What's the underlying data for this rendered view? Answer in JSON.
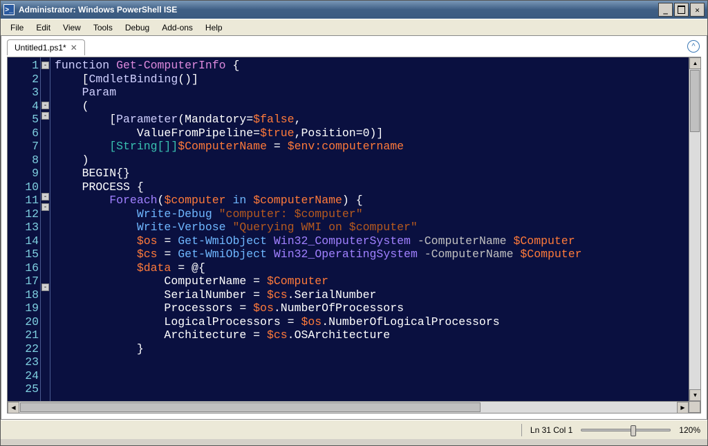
{
  "window": {
    "title": "Administrator: Windows PowerShell ISE",
    "icon_glyph": ">_"
  },
  "menu": {
    "items": [
      "File",
      "Edit",
      "View",
      "Tools",
      "Debug",
      "Add-ons",
      "Help"
    ]
  },
  "tabs": {
    "active": {
      "label": "Untitled1.ps1*",
      "close_glyph": "✕"
    },
    "help_glyph": "ⓘ"
  },
  "editor": {
    "line_numbers": [
      1,
      2,
      3,
      4,
      5,
      6,
      7,
      8,
      9,
      10,
      11,
      12,
      13,
      14,
      15,
      16,
      17,
      18,
      19,
      20,
      21,
      22,
      23,
      24,
      25
    ],
    "folds": {
      "1": "-",
      "4": "-",
      "5": "-",
      "11": "-",
      "12": "-",
      "18": "-"
    },
    "code_lines": [
      [
        [
          "k-blue",
          "function "
        ],
        [
          "k-fn",
          "Get-ComputerInfo"
        ],
        [
          "k-kw",
          " {"
        ]
      ],
      [
        [
          "k-kw",
          "    ["
        ],
        [
          "k-attr",
          "CmdletBinding"
        ],
        [
          "k-kw",
          "()]"
        ]
      ],
      [
        [
          "k-blue",
          "    Param"
        ]
      ],
      [
        [
          "k-kw",
          "    ("
        ]
      ],
      [
        [
          "k-kw",
          "        ["
        ],
        [
          "k-attr",
          "Parameter"
        ],
        [
          "k-kw",
          "(Mandatory="
        ],
        [
          "k-var",
          "$false"
        ],
        [
          "k-kw",
          ","
        ]
      ],
      [
        [
          "k-kw",
          "            ValueFromPipeline="
        ],
        [
          "k-var",
          "$true"
        ],
        [
          "k-kw",
          ",Position=0)]"
        ]
      ],
      [
        [
          "k-kw",
          "        "
        ],
        [
          "k-type",
          "[String[]]"
        ],
        [
          "k-var",
          "$ComputerName"
        ],
        [
          "k-kw",
          " = "
        ],
        [
          "k-var",
          "$env:computername"
        ]
      ],
      [
        [
          "k-kw",
          "    )"
        ]
      ],
      [
        [
          "k-kw",
          ""
        ]
      ],
      [
        [
          "k-kw",
          "    BEGIN{}"
        ]
      ],
      [
        [
          "k-kw",
          "    PROCESS {"
        ]
      ],
      [
        [
          "k-kw",
          "        "
        ],
        [
          "k-fore",
          "Foreach"
        ],
        [
          "k-kw",
          "("
        ],
        [
          "k-var",
          "$computer"
        ],
        [
          "k-kw",
          " "
        ],
        [
          "k-cmd",
          "in"
        ],
        [
          "k-kw",
          " "
        ],
        [
          "k-var",
          "$computerName"
        ],
        [
          "k-kw",
          ") {"
        ]
      ],
      [
        [
          "k-kw",
          "            "
        ],
        [
          "k-cmd",
          "Write-Debug"
        ],
        [
          "k-kw",
          " "
        ],
        [
          "k-str",
          "\"computer: $computer\""
        ]
      ],
      [
        [
          "k-kw",
          "            "
        ],
        [
          "k-cmd",
          "Write-Verbose"
        ],
        [
          "k-kw",
          " "
        ],
        [
          "k-str",
          "\"Querying WMI on $computer\""
        ]
      ],
      [
        [
          "k-kw",
          "            "
        ],
        [
          "k-var",
          "$os"
        ],
        [
          "k-kw",
          " = "
        ],
        [
          "k-cmd",
          "Get-WmiObject"
        ],
        [
          "k-kw",
          " "
        ],
        [
          "k-wmi",
          "Win32_ComputerSystem"
        ],
        [
          "k-kw",
          " "
        ],
        [
          "k-flag",
          "-ComputerName"
        ],
        [
          "k-kw",
          " "
        ],
        [
          "k-var",
          "$Computer"
        ]
      ],
      [
        [
          "k-kw",
          "            "
        ],
        [
          "k-var",
          "$cs"
        ],
        [
          "k-kw",
          " = "
        ],
        [
          "k-cmd",
          "Get-WmiObject"
        ],
        [
          "k-kw",
          " "
        ],
        [
          "k-wmi",
          "Win32_OperatingSystem"
        ],
        [
          "k-kw",
          " "
        ],
        [
          "k-flag",
          "-ComputerName"
        ],
        [
          "k-kw",
          " "
        ],
        [
          "k-var",
          "$Computer"
        ]
      ],
      [
        [
          "k-kw",
          ""
        ]
      ],
      [
        [
          "k-kw",
          "            "
        ],
        [
          "k-var",
          "$data"
        ],
        [
          "k-kw",
          " = @{"
        ]
      ],
      [
        [
          "k-kw",
          "                ComputerName = "
        ],
        [
          "k-var",
          "$Computer"
        ]
      ],
      [
        [
          "k-kw",
          "                SerialNumber = "
        ],
        [
          "k-var",
          "$cs"
        ],
        [
          "k-prop",
          ".SerialNumber"
        ]
      ],
      [
        [
          "k-kw",
          "                Processors = "
        ],
        [
          "k-var",
          "$os"
        ],
        [
          "k-prop",
          ".NumberOfProcessors"
        ]
      ],
      [
        [
          "k-kw",
          "                LogicalProcessors = "
        ],
        [
          "k-var",
          "$os"
        ],
        [
          "k-prop",
          ".NumberOfLogicalProcessors"
        ]
      ],
      [
        [
          "k-kw",
          "                Architecture = "
        ],
        [
          "k-var",
          "$cs"
        ],
        [
          "k-prop",
          ".OSArchitecture"
        ]
      ],
      [
        [
          "k-kw",
          "            }"
        ]
      ],
      [
        [
          "k-kw",
          ""
        ]
      ]
    ]
  },
  "status": {
    "cursor": "Ln 31  Col 1",
    "zoom": "120%"
  }
}
